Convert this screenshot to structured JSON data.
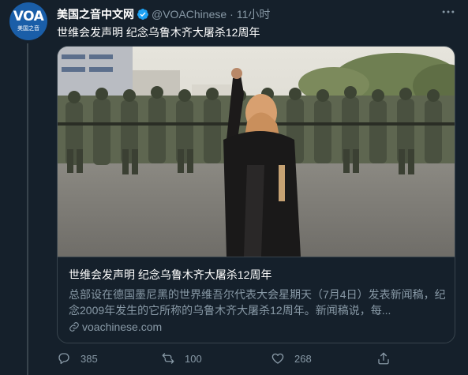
{
  "account": {
    "name": "美国之音中文网",
    "handle": "@VOAChinese",
    "time": "11小时",
    "avatar_logo": "VOA",
    "avatar_sub": "美国之音"
  },
  "tweet": {
    "text": "世维会发声明 纪念乌鲁木齐大屠杀12周年"
  },
  "card": {
    "title": "世维会发声明 纪念乌鲁木齐大屠杀12周年",
    "description": "总部设在德国墨尼黑的世界维吾尔代表大会星期天（7月4日）发表新闻稿，纪念2009年发生的它所称的乌鲁木齐大屠杀12周年。新闻稿说，每...",
    "domain": "voachinese.com"
  },
  "actions": {
    "reply_count": "385",
    "retweet_count": "100",
    "like_count": "268"
  },
  "icons": [
    "verified-badge-icon",
    "more-icon",
    "link-icon",
    "reply-icon",
    "retweet-icon",
    "like-icon",
    "share-icon"
  ],
  "colors": {
    "background": "#15202b",
    "secondary_text": "#8899a6",
    "border": "#38444d",
    "verified": "#1da1f2"
  }
}
